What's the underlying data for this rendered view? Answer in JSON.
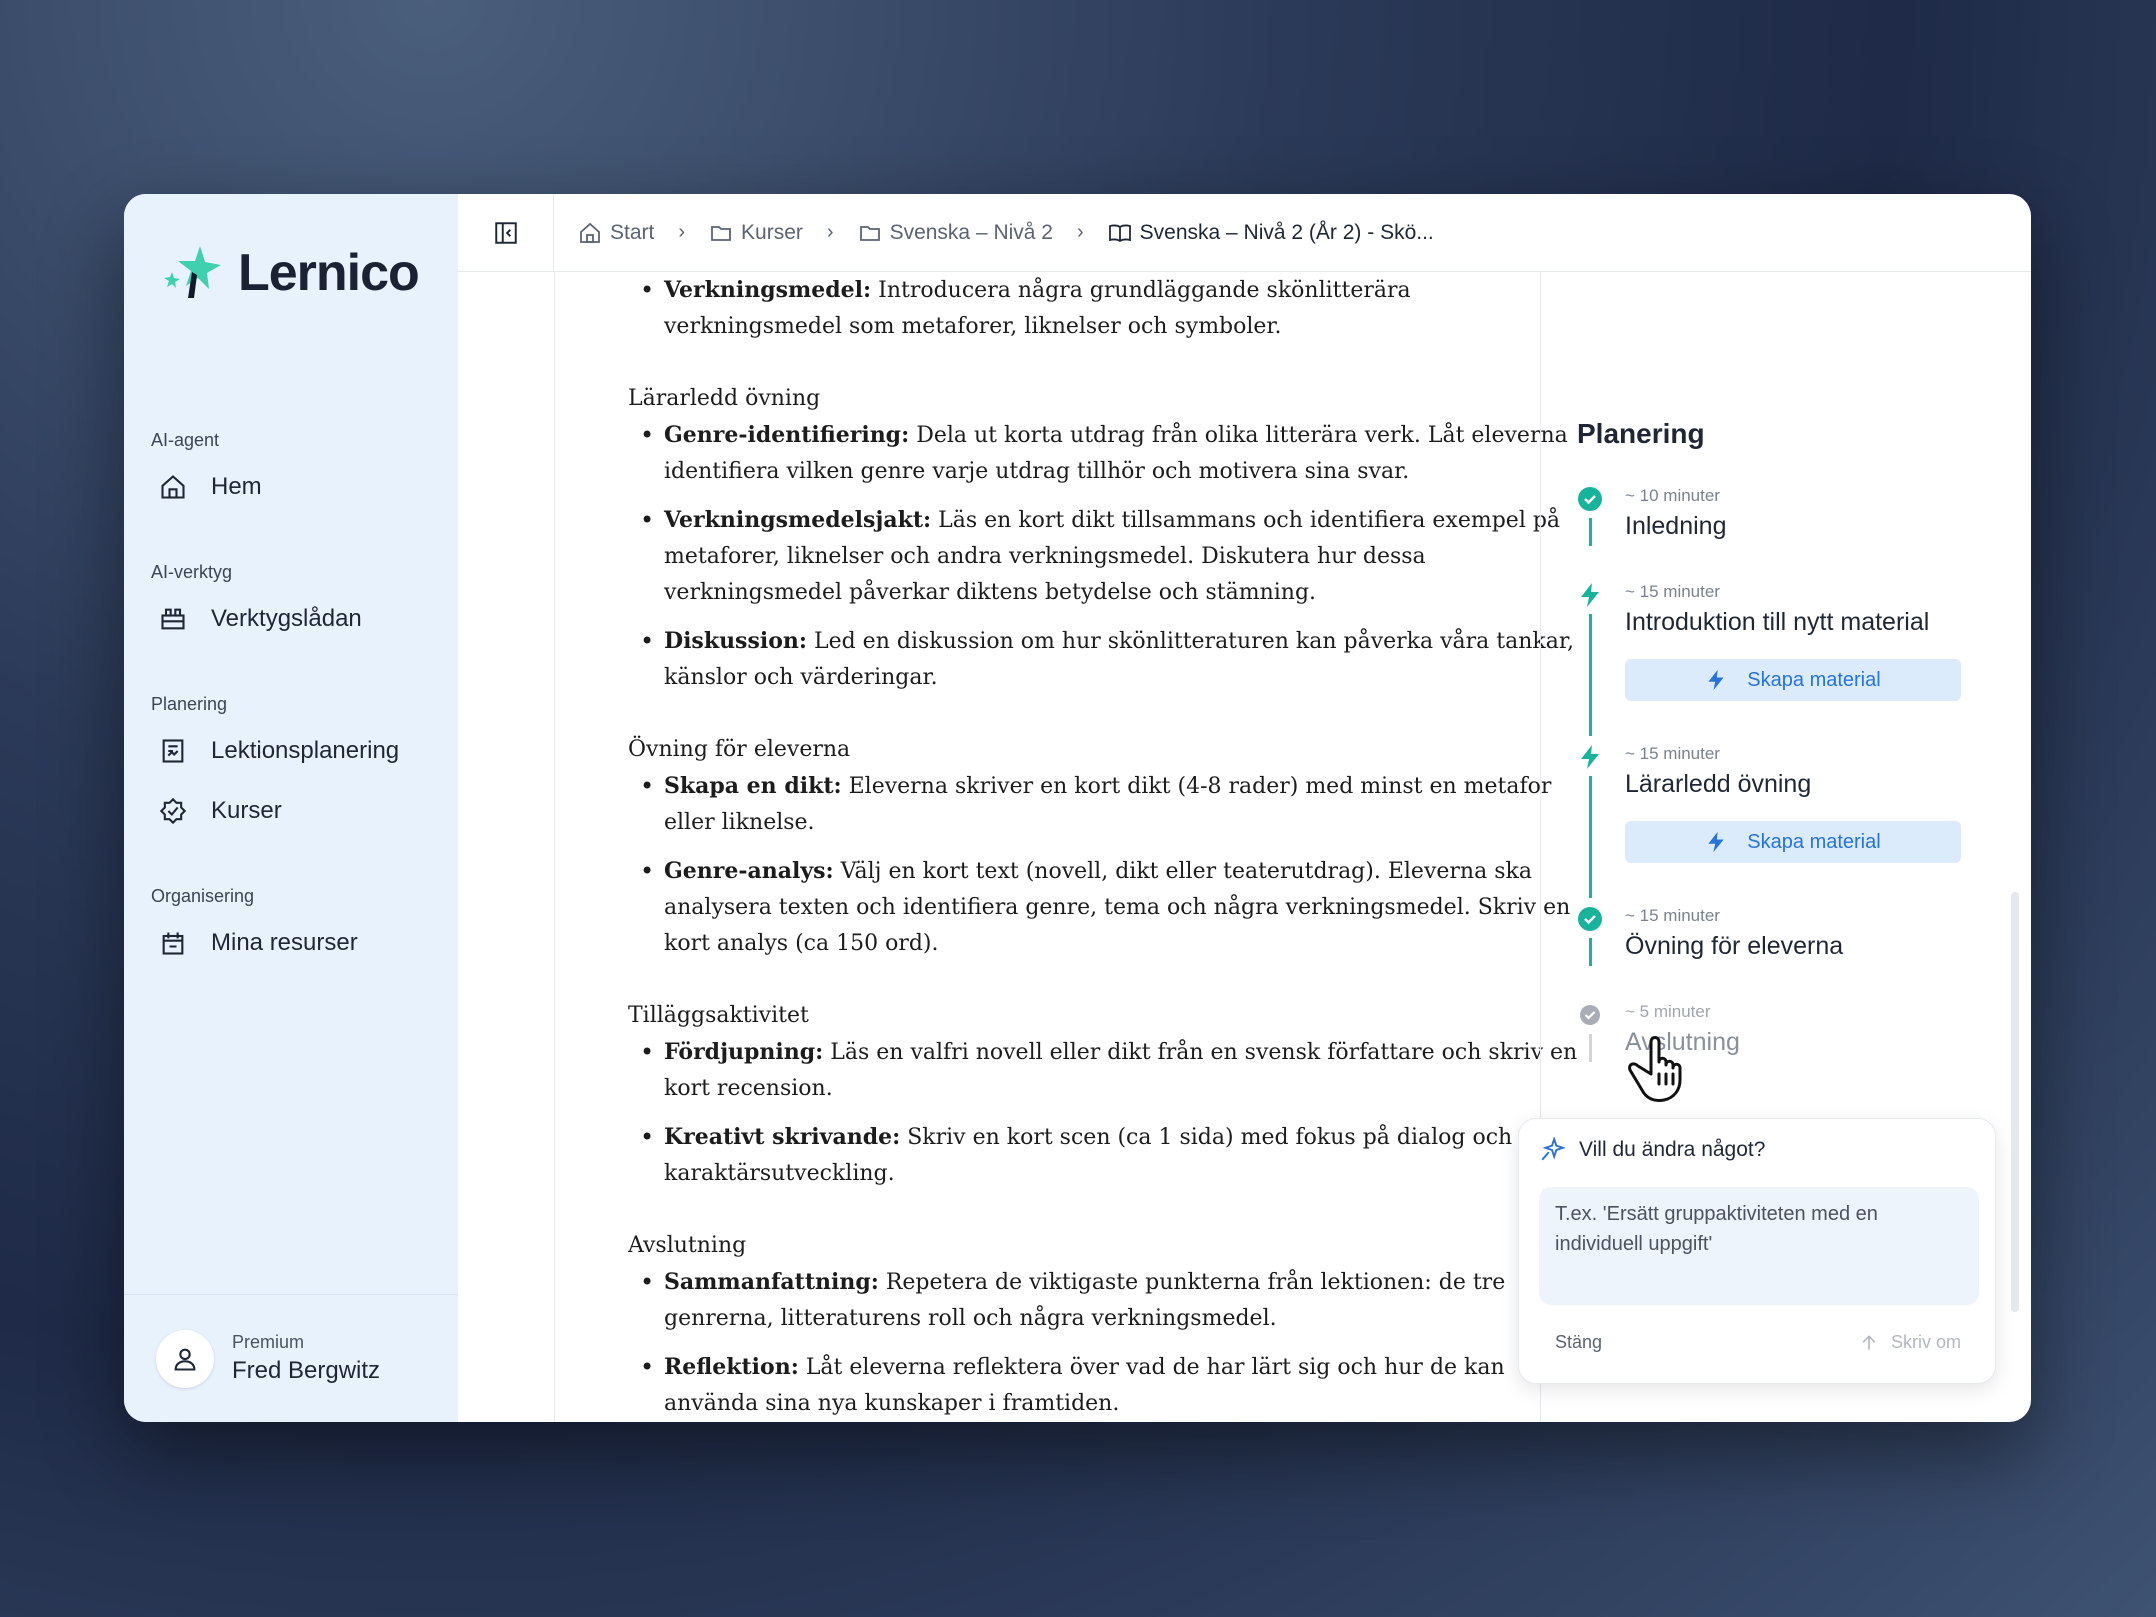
{
  "app": {
    "name": "Lernico"
  },
  "sidebar": {
    "sections": [
      {
        "label": "AI-agent",
        "items": [
          {
            "label": "Hem",
            "icon": "home-icon"
          }
        ]
      },
      {
        "label": "AI-verktyg",
        "items": [
          {
            "label": "Verktygslådan",
            "icon": "toolbox-icon"
          }
        ]
      },
      {
        "label": "Planering",
        "items": [
          {
            "label": "Lektionsplanering",
            "icon": "lesson-plan-icon"
          },
          {
            "label": "Kurser",
            "icon": "course-badge-icon"
          }
        ]
      },
      {
        "label": "Organisering",
        "items": [
          {
            "label": "Mina resurser",
            "icon": "resources-icon"
          }
        ]
      }
    ],
    "user": {
      "plan": "Premium",
      "name": "Fred Bergwitz"
    }
  },
  "breadcrumb": [
    {
      "label": "Start",
      "icon": "home-icon"
    },
    {
      "label": "Kurser",
      "icon": "folder-icon"
    },
    {
      "label": "Svenska – Nivå 2",
      "icon": "folder-icon"
    },
    {
      "label": "Svenska – Nivå 2 (År 2) - Skö...",
      "icon": "book-icon"
    }
  ],
  "content": {
    "intro_item": {
      "term": "Verkningsmedel:",
      "text": " Introducera några grundläggande skönlitterära verkningsmedel som metaforer, liknelser och symboler."
    },
    "sections": [
      {
        "heading": "Lärarledd övning",
        "items": [
          {
            "term": "Genre-identifiering:",
            "text": " Dela ut korta utdrag från olika litterära verk. Låt eleverna identifiera vilken genre varje utdrag tillhör och motivera sina svar."
          },
          {
            "term": "Verkningsmedelsjakt:",
            "text": " Läs en kort dikt tillsammans och identifiera exempel på metaforer, liknelser och andra verkningsmedel. Diskutera hur dessa verkningsmedel påverkar diktens betydelse och stämning."
          },
          {
            "term": "Diskussion:",
            "text": " Led en diskussion om hur skönlitteraturen kan påverka våra tankar, känslor och värderingar."
          }
        ]
      },
      {
        "heading": "Övning för eleverna",
        "items": [
          {
            "term": "Skapa en dikt:",
            "text": " Eleverna skriver en kort dikt (4-8 rader) med minst en metafor eller liknelse."
          },
          {
            "term": "Genre-analys:",
            "text": " Välj en kort text (novell, dikt eller teaterutdrag). Eleverna ska analysera texten och identifiera genre, tema och några verkningsmedel. Skriv en kort analys (ca 150 ord)."
          }
        ]
      },
      {
        "heading": "Tilläggsaktivitet",
        "items": [
          {
            "term": "Fördjupning:",
            "text": " Läs en valfri novell eller dikt från en svensk författare och skriv en kort recension."
          },
          {
            "term": "Kreativt skrivande:",
            "text": " Skriv en kort scen (ca 1 sida) med fokus på dialog och karaktärsutveckling."
          }
        ]
      },
      {
        "heading": "Avslutning",
        "items": [
          {
            "term": "Sammanfattning:",
            "text": " Repetera de viktigaste punkterna från lektionen: de tre genrerna, litteraturens roll och några verkningsmedel."
          },
          {
            "term": "Reflektion:",
            "text": " Låt eleverna reflektera över vad de har lärt sig och hur de kan använda sina nya kunskaper i framtiden."
          }
        ]
      }
    ]
  },
  "planning": {
    "title": "Planering",
    "steps": [
      {
        "time": "~ 10 minuter",
        "title": "Inledning",
        "status": "done"
      },
      {
        "time": "~ 15 minuter",
        "title": "Introduktion till nytt material",
        "status": "action",
        "button": "Skapa material"
      },
      {
        "time": "~ 15 minuter",
        "title": "Lärarledd övning",
        "status": "action",
        "button": "Skapa material"
      },
      {
        "time": "~ 15 minuter",
        "title": "Övning för eleverna",
        "status": "done"
      },
      {
        "time": "~ 5 minuter",
        "title": "Avslutning",
        "status": "pending"
      }
    ]
  },
  "edit": {
    "title": "Vill du ändra något?",
    "placeholder": "T.ex. 'Ersätt gruppaktiviteten med en individuell uppgift'",
    "close_label": "Stäng",
    "submit_label": "Skriv om"
  },
  "colors": {
    "accent": "#17b39a",
    "link": "#2673dd",
    "sidebar_bg": "#e8f2fd"
  }
}
